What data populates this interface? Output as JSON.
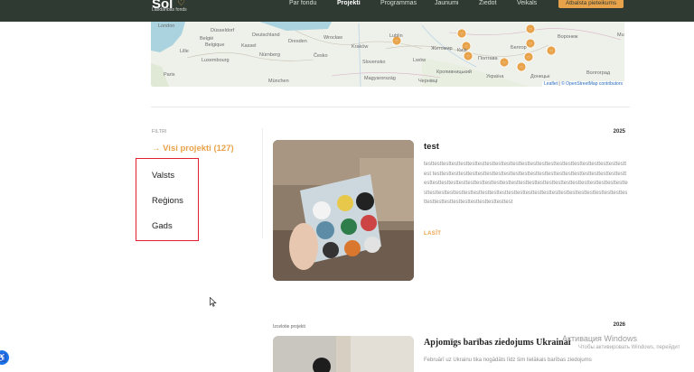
{
  "header": {
    "logo_text": "Sol",
    "logo_sub": "Labdarības fonds",
    "nav": [
      {
        "label": "Par fondu",
        "active": false
      },
      {
        "label": "Projekti",
        "active": true
      },
      {
        "label": "Programmas",
        "active": false
      },
      {
        "label": "Jaunumi",
        "active": false
      },
      {
        "label": "Ziedot",
        "active": false
      },
      {
        "label": "Veikals",
        "active": false
      }
    ],
    "cta_label": "Atbalsta pieteikums"
  },
  "map": {
    "labels": [
      "London",
      "Düsseldorf",
      "Deutschland",
      "Dresden",
      "Wrocław",
      "Kraków",
      "Lublin",
      "Житомир",
      "Київ",
      "Полтава",
      "Україна",
      "Белгор",
      "Донецьк",
      "Волгоград",
      "Belgié",
      "Belgique",
      "Paris",
      "Luxembourg",
      "Nürnberg",
      "Česko",
      "Slovensko",
      "Magyarország",
      "München",
      "Кропивницький",
      "Чернівці",
      "Воронеж",
      "Mu",
      "Lille",
      "Kassel",
      "Lwów"
    ],
    "attribution_leaflet": "Leaflet",
    "attribution_osm": "© OpenStreetMap contributors"
  },
  "filters": {
    "title": "FILTRI",
    "all_label": "→  Visi projekti (127)",
    "items": [
      "Valsts",
      "Reģions",
      "Gads"
    ]
  },
  "projects": [
    {
      "year": "2025",
      "title": "test",
      "text": "testtesttesttesttesttesttesttesttesttesttesttesttesttesttesttesttesttesttesttesttesttesttesttest testtesttesttesttesttesttesttesttesttesttesttesttesttesttesttesttesttesttesttesttesttesttesttesttesttesttesttesttesttesttesttesttesttesttesttesttesttesttesttesttesttesttesttesttesttesttesttesttesttesttesttesttesttesttesttesttesttesttesttesttesttesttesttesttesttesttesttesttesttesttesttesttesttesttesttesttesttesttest",
      "read_label": "LASĪT"
    },
    {
      "year": "2026",
      "featured_label": "Izcelotie projekti",
      "title": "Apjomīgs barības ziedojums Ukrainai",
      "text": "Februārī uz Ukrainu tika nogādāts līdz šim lielākais barības ziedojums"
    }
  ],
  "system": {
    "activation_title": "Активация Windows",
    "activation_sub": "Чтобы активировать Windows, перейдит"
  },
  "colors": {
    "accent": "#e8a24a",
    "header_bg": "#2f3a33",
    "highlight_box": "#e0202c"
  }
}
